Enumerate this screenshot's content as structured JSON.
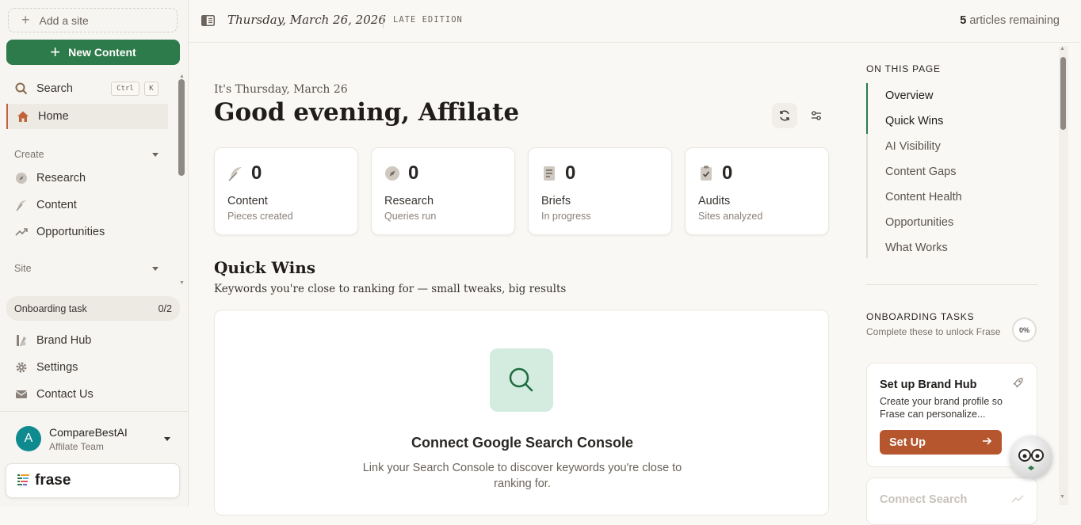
{
  "sidebar": {
    "add_site_label": "Add a site",
    "new_content_label": "New Content",
    "search_label": "Search",
    "search_shortcut_1": "Ctrl",
    "search_shortcut_2": "K",
    "home_label": "Home",
    "create_section": "Create",
    "create_items": [
      "Research",
      "Content",
      "Opportunities"
    ],
    "site_section": "Site",
    "onboarding_label": "Onboarding task",
    "onboarding_count": "0/2",
    "bottom_items": [
      "Brand Hub",
      "Settings",
      "Contact Us"
    ],
    "user": {
      "initial": "A",
      "name": "CompareBestAI",
      "team": "Affilate Team"
    },
    "brand": "frase"
  },
  "topbar": {
    "date": "Thursday, March 26, 2026",
    "edition": "LATE EDITION",
    "remaining_count": "5",
    "remaining_label": "articles remaining"
  },
  "main": {
    "greeting_small": "It's Thursday, March 26",
    "greeting_big": "Good evening, Affilate",
    "stats": [
      {
        "icon": "feather-icon",
        "value": "0",
        "label": "Content",
        "sub": "Pieces created"
      },
      {
        "icon": "compass-icon",
        "value": "0",
        "label": "Research",
        "sub": "Queries run"
      },
      {
        "icon": "document-icon",
        "value": "0",
        "label": "Briefs",
        "sub": "In progress"
      },
      {
        "icon": "clipboard-check-icon",
        "value": "0",
        "label": "Audits",
        "sub": "Sites analyzed"
      }
    ],
    "quick_wins_title": "Quick Wins",
    "quick_wins_sub": "Keywords you're close to ranking for — small tweaks, big results",
    "gsc_title": "Connect Google Search Console",
    "gsc_desc": "Link your Search Console to discover keywords you're close to ranking for."
  },
  "right_panel": {
    "on_this_page_title": "ON THIS PAGE",
    "toc": [
      "Overview",
      "Quick Wins",
      "AI Visibility",
      "Content Gaps",
      "Content Health",
      "Opportunities",
      "What Works"
    ],
    "onboarding_title": "ONBOARDING TASKS",
    "onboarding_sub": "Complete these to unlock Frase",
    "onboarding_progress": "0%",
    "task1_title": "Set up Brand Hub",
    "task1_desc": "Create your brand profile so Frase can personalize...",
    "task1_button": "Set Up",
    "task2_title": "Connect Search"
  },
  "colors": {
    "accent_green": "#2d7a4a",
    "accent_rust": "#b5562e",
    "avatar_teal": "#0f8a8f"
  }
}
